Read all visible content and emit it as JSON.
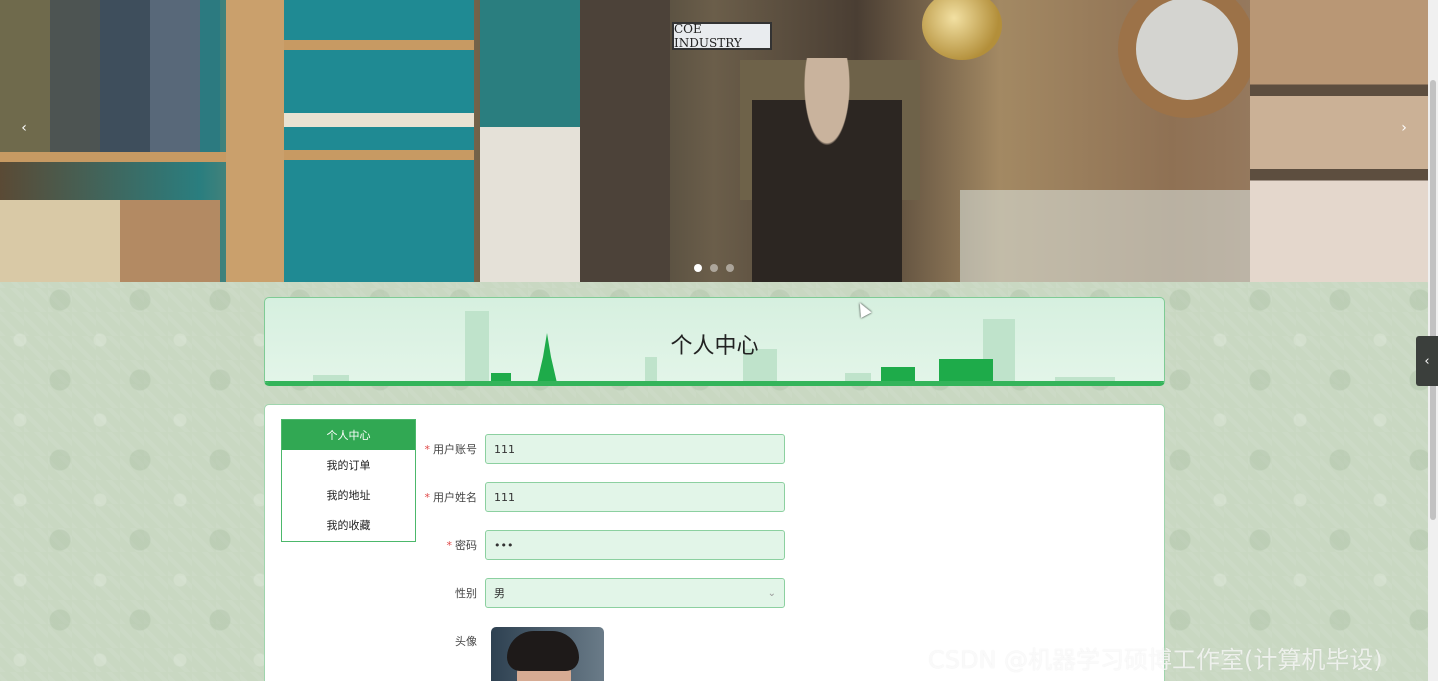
{
  "banner": {
    "sign_text": "COE INDUSTRY",
    "prev_arrow": "‹",
    "next_arrow": "›",
    "slide_count": 3,
    "active_slide": 1
  },
  "page": {
    "title": "个人中心"
  },
  "side_menu": {
    "items": [
      {
        "label": "个人中心",
        "active": true
      },
      {
        "label": "我的订单",
        "active": false
      },
      {
        "label": "我的地址",
        "active": false
      },
      {
        "label": "我的收藏",
        "active": false
      }
    ]
  },
  "form": {
    "username": {
      "label": "用户账号",
      "value": "111",
      "required": true
    },
    "realname": {
      "label": "用户姓名",
      "value": "111",
      "required": true
    },
    "password": {
      "label": "密码",
      "value": "•••",
      "required": true
    },
    "gender": {
      "label": "性别",
      "value": "男",
      "required": false
    },
    "avatar": {
      "label": "头像",
      "required": false
    },
    "required_mark": "*"
  },
  "side_toggle": {
    "icon": "chevron-left-icon",
    "glyph": "‹"
  },
  "watermark": {
    "text": "CSDN @机器学习硕博工作室(计算机毕设)"
  },
  "colors": {
    "accent": "#31a853",
    "input_bg": "#e2f5e8",
    "required": "#e04848"
  }
}
